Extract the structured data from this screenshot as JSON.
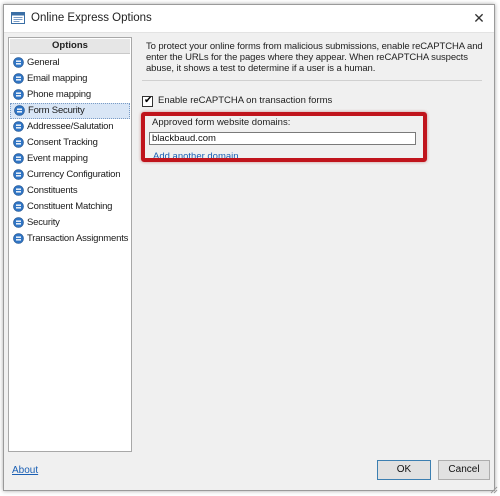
{
  "window": {
    "title": "Online Express Options",
    "close_glyph": "✕"
  },
  "sidebar": {
    "header": "Options",
    "items": [
      {
        "label": "General",
        "icon": "circle-arrow-icon"
      },
      {
        "label": "Email mapping",
        "icon": "circle-arrow-icon"
      },
      {
        "label": "Phone mapping",
        "icon": "circle-arrow-icon"
      },
      {
        "label": "Form Security",
        "icon": "circle-arrow-icon",
        "selected": true
      },
      {
        "label": "Addressee/Salutation",
        "icon": "circle-arrow-icon"
      },
      {
        "label": "Consent Tracking",
        "icon": "circle-arrow-icon"
      },
      {
        "label": "Event mapping",
        "icon": "circle-arrow-icon"
      },
      {
        "label": "Currency Configuration",
        "icon": "circle-arrow-icon"
      },
      {
        "label": "Constituents",
        "icon": "circle-arrow-icon"
      },
      {
        "label": "Constituent Matching",
        "icon": "circle-arrow-icon"
      },
      {
        "label": "Security",
        "icon": "circle-arrow-icon"
      },
      {
        "label": "Transaction Assignments",
        "icon": "circle-arrow-icon"
      }
    ]
  },
  "form_security": {
    "description": "To protect your online forms from malicious submissions, enable reCAPTCHA and enter the URLs for the pages where they appear. When reCAPTCHA suspects abuse, it shows a test to determine if a user is a human.",
    "checkbox_label": "Enable reCAPTCHA on transaction forms",
    "checkbox_checked": true,
    "checkbox_mark": "✔",
    "domains_label": "Approved form website domains:",
    "domain_value": "blackbaud.com",
    "add_domain_link": "Add another domain"
  },
  "footer": {
    "about_link": "About",
    "ok_label": "OK",
    "cancel_label": "Cancel"
  },
  "colors": {
    "highlight": "#c0141c",
    "link": "#1a5fb4",
    "selected_item": "#d9e6f6"
  }
}
